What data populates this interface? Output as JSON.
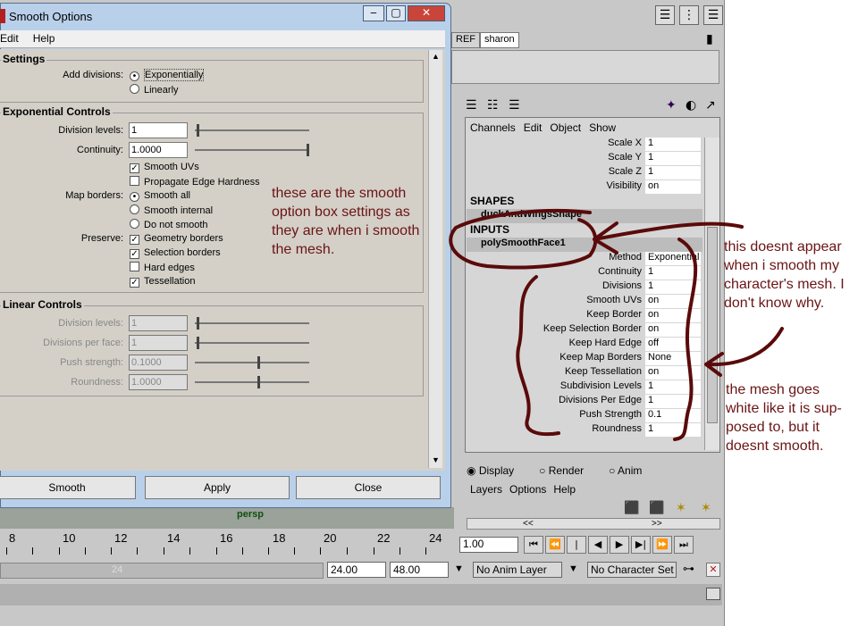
{
  "dialog": {
    "title": "Smooth Options",
    "menu": [
      "Edit",
      "Help"
    ],
    "settings": {
      "title": "Settings",
      "add_divisions_label": "Add divisions:",
      "options": [
        "Exponentially",
        "Linearly"
      ],
      "selected": "Exponentially"
    },
    "exponential": {
      "title": "Exponential Controls",
      "division_levels_label": "Division levels:",
      "division_levels": "1",
      "continuity_label": "Continuity:",
      "continuity": "1.0000",
      "smooth_uvs": "Smooth UVs",
      "propagate": "Propagate Edge Hardness",
      "map_borders_label": "Map borders:",
      "map_borders": [
        "Smooth all",
        "Smooth internal",
        "Do not smooth"
      ],
      "preserve_label": "Preserve:",
      "preserve": [
        "Geometry borders",
        "Selection borders",
        "Hard edges",
        "Tessellation"
      ]
    },
    "linear": {
      "title": "Linear Controls",
      "division_levels_label": "Division levels:",
      "division_levels": "1",
      "divisions_per_face_label": "Divisions per face:",
      "divisions_per_face": "1",
      "push_strength_label": "Push strength:",
      "push_strength": "0.1000",
      "roundness_label": "Roundness:",
      "roundness": "1.0000"
    },
    "buttons": {
      "smooth": "Smooth",
      "apply": "Apply",
      "close": "Close"
    }
  },
  "shelf_tabs": [
    "REF",
    "sharon"
  ],
  "channel_box": {
    "menu": [
      "Channels",
      "Edit",
      "Object",
      "Show"
    ],
    "transform_rows": [
      {
        "k": "Scale X",
        "v": "1"
      },
      {
        "k": "Scale Y",
        "v": "1"
      },
      {
        "k": "Scale Z",
        "v": "1"
      },
      {
        "k": "Visibility",
        "v": "on"
      }
    ],
    "shapes_header": "SHAPES",
    "shape_node": "duckAndWingsShape",
    "inputs_header": "INPUTS",
    "input_node": "polySmoothFace1",
    "input_rows": [
      {
        "k": "Method",
        "v": "Exponential"
      },
      {
        "k": "Continuity",
        "v": "1"
      },
      {
        "k": "Divisions",
        "v": "1"
      },
      {
        "k": "Smooth UVs",
        "v": "on"
      },
      {
        "k": "Keep Border",
        "v": "on"
      },
      {
        "k": "Keep Selection Border",
        "v": "on"
      },
      {
        "k": "Keep Hard Edge",
        "v": "off"
      },
      {
        "k": "Keep Map Borders",
        "v": "None"
      },
      {
        "k": "Keep Tessellation",
        "v": "on"
      },
      {
        "k": "Subdivision Levels",
        "v": "1"
      },
      {
        "k": "Divisions Per Edge",
        "v": "1"
      },
      {
        "k": "Push Strength",
        "v": "0.1"
      },
      {
        "k": "Roundness",
        "v": "1"
      }
    ]
  },
  "layer_editor": {
    "modes": [
      "Display",
      "Render",
      "Anim"
    ],
    "menu": [
      "Layers",
      "Options",
      "Help"
    ],
    "scroll_left": "<<",
    "scroll_right": ">>"
  },
  "viewport": {
    "camera": "persp"
  },
  "timeline": {
    "ticks": [
      "8",
      "10",
      "12",
      "14",
      "16",
      "18",
      "20",
      "22",
      "24"
    ],
    "current_frame": "1.00",
    "range_marker": "24",
    "end_time": "24.00",
    "playback_end": "48.00",
    "anim_layer": "No Anim Layer",
    "character_set": "No Character Set"
  },
  "annotations": {
    "note1": "these are the smooth option box settings as they are when i smooth the mesh.",
    "note2": "this doesnt appear when i smooth my character's mesh.  I don't know why.",
    "note3": "the mesh goes white like it is sup-posed to, but it doesnt smooth."
  },
  "colors": {
    "annotation": "#6b1414",
    "maya_gray": "#c8c8c8",
    "dialog_frame": "#b9d0ea"
  }
}
